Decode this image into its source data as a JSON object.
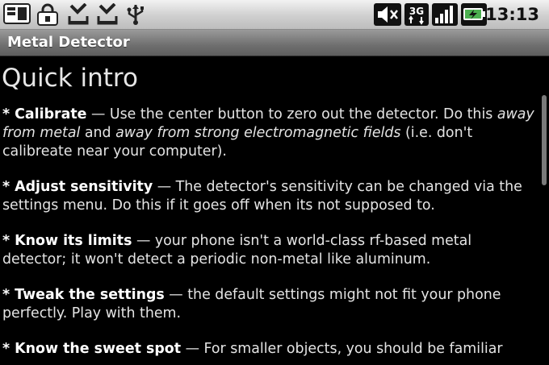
{
  "status_bar": {
    "icons": [
      "sd-card-icon",
      "lock-icon",
      "download-done-icon",
      "download-done-icon",
      "usb-icon"
    ],
    "right_icons": [
      "mute-icon",
      "3g-icon",
      "signal-icon",
      "battery-charging-icon"
    ],
    "network_label": "3G",
    "time": "13:13"
  },
  "app": {
    "title": "Metal Detector"
  },
  "content": {
    "heading": "Quick intro",
    "tips": [
      {
        "title": "* Calibrate",
        "sep": " — ",
        "text_a": "Use the center button to zero out the detector. Do this ",
        "em_a": "away from metal",
        "text_b": " and ",
        "em_b": "away from strong electromagnetic fields",
        "text_c": " (i.e. don't calibreate near your computer)."
      },
      {
        "title": "* Adjust sensitivity",
        "sep": " — ",
        "text": "The detector's sensitivity can be changed via the settings menu. Do this if it goes off when its not supposed to."
      },
      {
        "title": "* Know its limits",
        "sep": " — ",
        "text": "your phone isn't a world-class rf-based metal detector; it won't detect a periodic non-metal like aluminum."
      },
      {
        "title": "* Tweak the settings",
        "sep": " — ",
        "text": "the default settings might not fit your phone perfectly. Play with them."
      },
      {
        "title": "* Know the sweet spot",
        "sep": " — ",
        "text": "For smaller objects, you should be familiar"
      }
    ]
  },
  "colors": {
    "background": "#000000",
    "status_bar": "#cfcfcf",
    "title_bar": "#6f6f6f",
    "battery_accent": "#4caf50"
  }
}
